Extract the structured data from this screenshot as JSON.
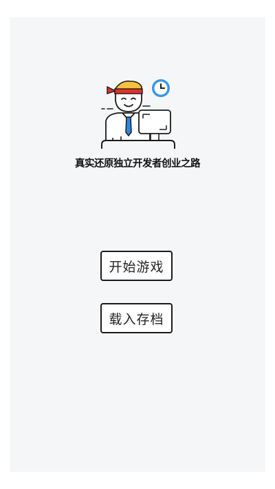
{
  "app": {
    "tagline": "真实还原独立开发者创业之路"
  },
  "menu": {
    "start_label": "开始游戏",
    "load_label": "载入存档"
  },
  "icons": {
    "logo": "developer-at-desk-icon"
  },
  "colors": {
    "background": "#f5f6f8",
    "headband": "#e3322b",
    "hair": "#f5c23e",
    "tie": "#2f86e0",
    "clock": "#3a96e8",
    "outline": "#1a1a1a"
  }
}
